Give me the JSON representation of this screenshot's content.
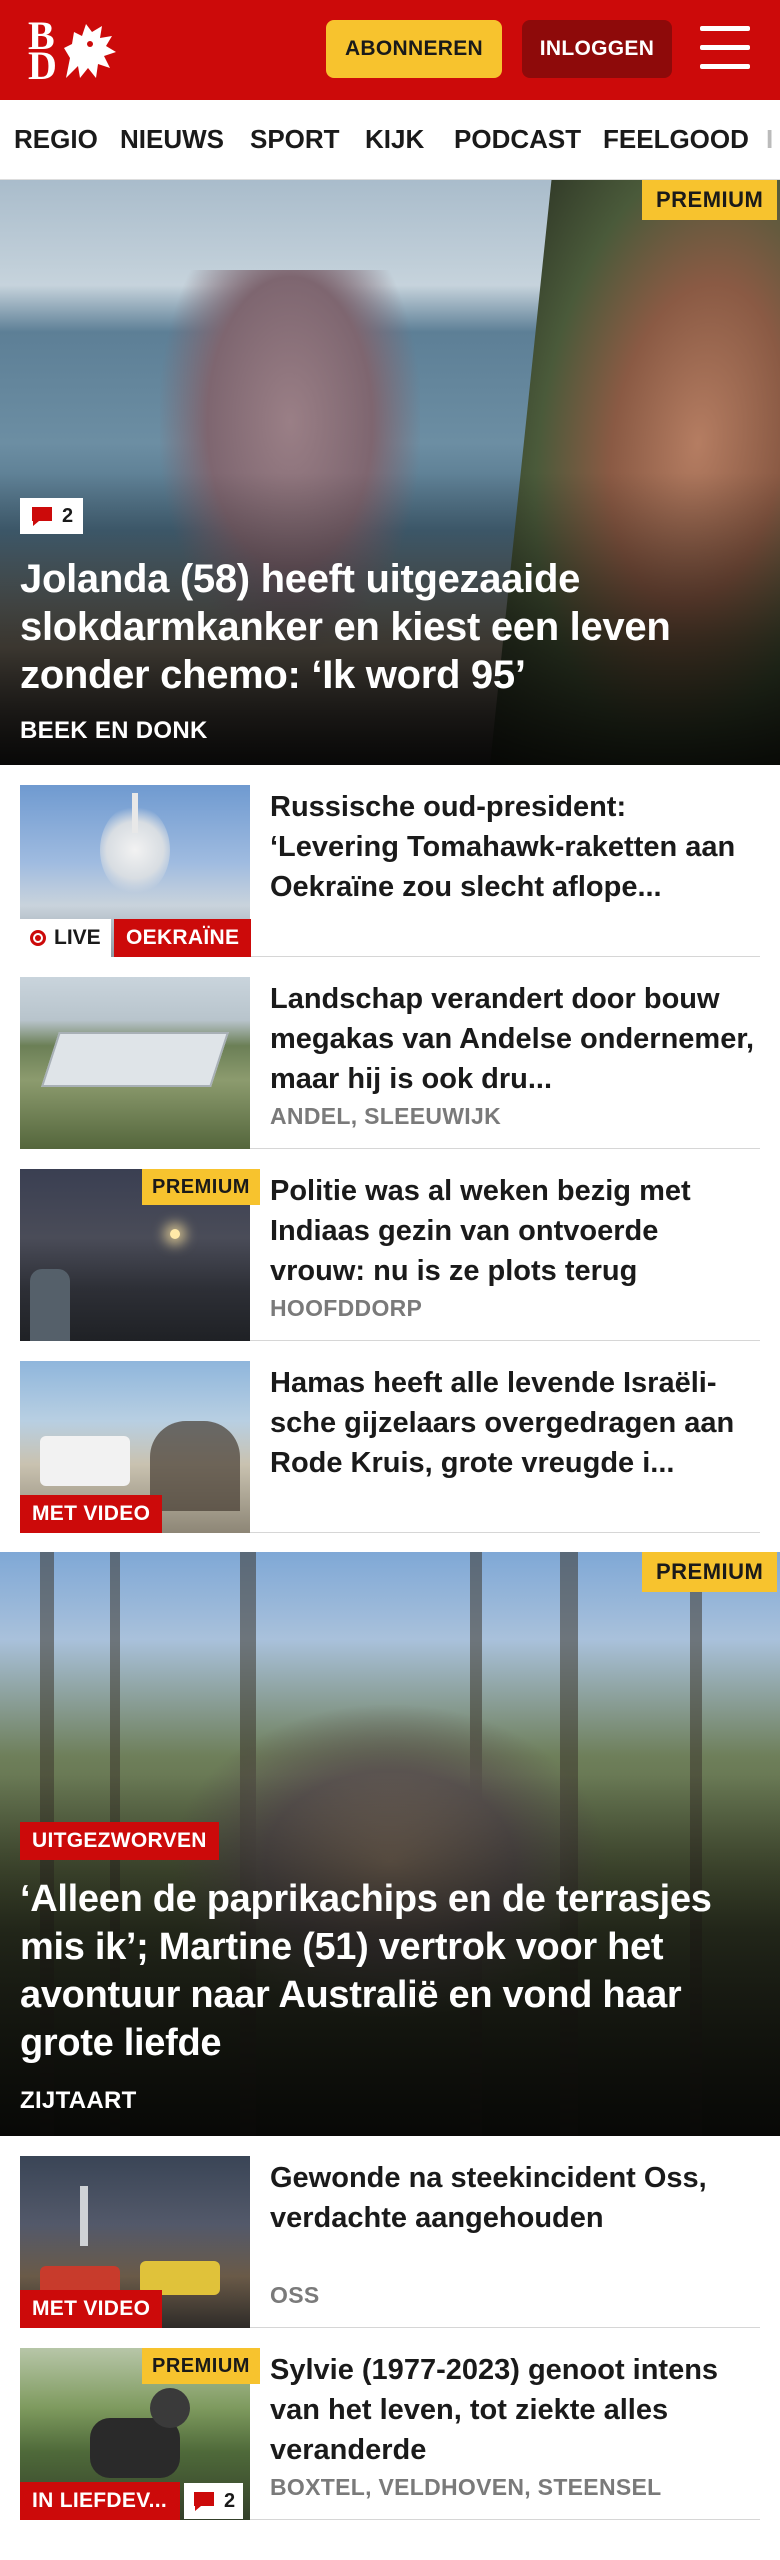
{
  "header": {
    "logo_b": "B",
    "logo_d": "D",
    "subscribe_label": "ABONNEREN",
    "login_label": "INLOGGEN"
  },
  "nav": [
    "REGIO",
    "NIEUWS",
    "SPORT",
    "KIJK",
    "PODCAST",
    "FEELGOOD",
    "I"
  ],
  "hero": {
    "premium": "PREMIUM",
    "comments": "2",
    "title": "Jolanda (58) heeft uitgezaaide slokdarmkanker en kiest een leven zonder chemo: ‘Ik word 95’",
    "location": "BEEK EN DONK"
  },
  "articles": [
    {
      "title": "Russische oud-president: ‘Levering Tomahawk-raketten aan Oekraïne zou slecht aflope...",
      "live": "LIVE",
      "tag": "OEKRAÏNE",
      "location": ""
    },
    {
      "title": "Landschap verandert door bouw megakas van Andelse ondernemer, maar hij is ook dru...",
      "location": "ANDEL, SLEEUWIJK"
    },
    {
      "title": "Politie was al weken bezig met Indiaas gezin van ontvoerde vrouw: nu is ze plots terug",
      "premium": "PREMIUM",
      "location": "HOOFDDORP"
    },
    {
      "title": "Hamas heeft alle levende Israëli-sche gijzelaars overgedragen aan Rode Kruis, grote vreugde i...",
      "tag": "MET VIDEO",
      "location": ""
    }
  ],
  "feature": {
    "premium": "PREMIUM",
    "tag": "UITGEZWORVEN",
    "title": "‘Alleen de paprikachips en de terrasjes mis ik’; Martine (51) vertrok voor het avontuur naar Australië en vond haar grote liefde",
    "location": "ZIJTAART"
  },
  "articles2": [
    {
      "title": "Gewonde na steekincident Oss, verdachte aangehouden",
      "tag": "MET VIDEO",
      "location": "OSS"
    },
    {
      "title": "Sylvie (1977-2023) genoot intens van het leven, tot ziekte alles veranderde",
      "premium": "PREMIUM",
      "tag": "IN LIEFDEV...",
      "comments": "2",
      "location": "BOXTEL, VELDHOVEN, STEENSEL"
    }
  ],
  "colors": {
    "brand_red": "#cc0a0a",
    "dark_red": "#8e0a0a",
    "premium_yellow": "#f7c32e"
  }
}
